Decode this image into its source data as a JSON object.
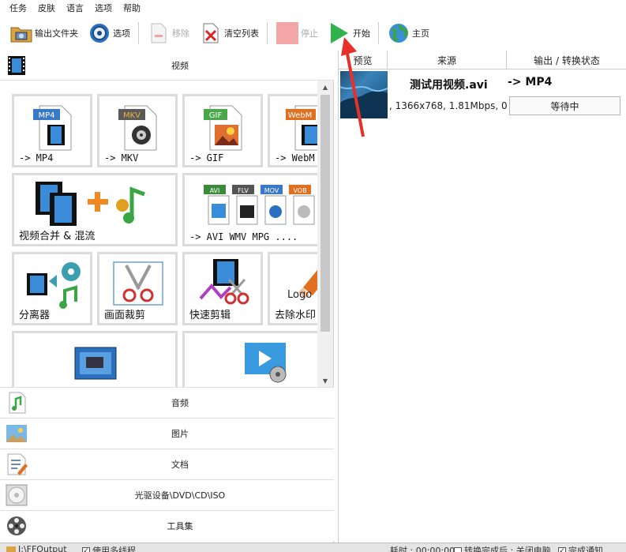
{
  "menu": [
    "任务",
    "皮肤",
    "语言",
    "选项",
    "帮助"
  ],
  "toolbar": {
    "output_folder": "输出文件夹",
    "options": "选项",
    "remove": "移除",
    "clear_list": "清空列表",
    "stop": "停止",
    "start": "开始",
    "home": "主页"
  },
  "left": {
    "video_header": "视频",
    "tiles": {
      "mp4": {
        "badge": "MP4",
        "label": "-> MP4"
      },
      "mkv": {
        "badge": "MKV",
        "label": "-> MKV"
      },
      "gif": {
        "badge": "GIF",
        "label": "-> GIF"
      },
      "webm": {
        "badge": "WebM",
        "label": "-> WebM"
      },
      "merge": {
        "label": "视频合并 & 混流"
      },
      "multi": {
        "badges": [
          "AVI",
          "FLV",
          "MOV",
          "VOB"
        ],
        "label": "-> AVI WMV MPG ...."
      },
      "splitter": {
        "label": "分离器"
      },
      "crop": {
        "label": "画面裁剪"
      },
      "quickcut": {
        "label": "快速剪辑"
      },
      "watermark": {
        "logo": "Logo",
        "label": "去除水印"
      }
    },
    "categories": [
      "音频",
      "图片",
      "文档",
      "光驱设备\\DVD\\CD\\ISO",
      "工具集"
    ]
  },
  "right": {
    "columns": [
      "预览",
      "来源",
      "输出 / 转换状态"
    ],
    "task": {
      "file_name": "测试用视频.avi",
      "file_info": ", 1366x768, 1.81Mbps, 0",
      "output_format": "-> MP4",
      "status": "等待中"
    }
  },
  "statusbar": {
    "path": "I:\\FFOutput",
    "multithread": "使用多线程",
    "elapsed": "耗时 : 00:00:00",
    "after_convert": "转换完成后 : 关闭电脑",
    "notify": "完成通知"
  },
  "colors": {
    "accent_green": "#2fb34a",
    "annotation_red": "#e8302a",
    "tile_border": "#dcdcdc"
  }
}
